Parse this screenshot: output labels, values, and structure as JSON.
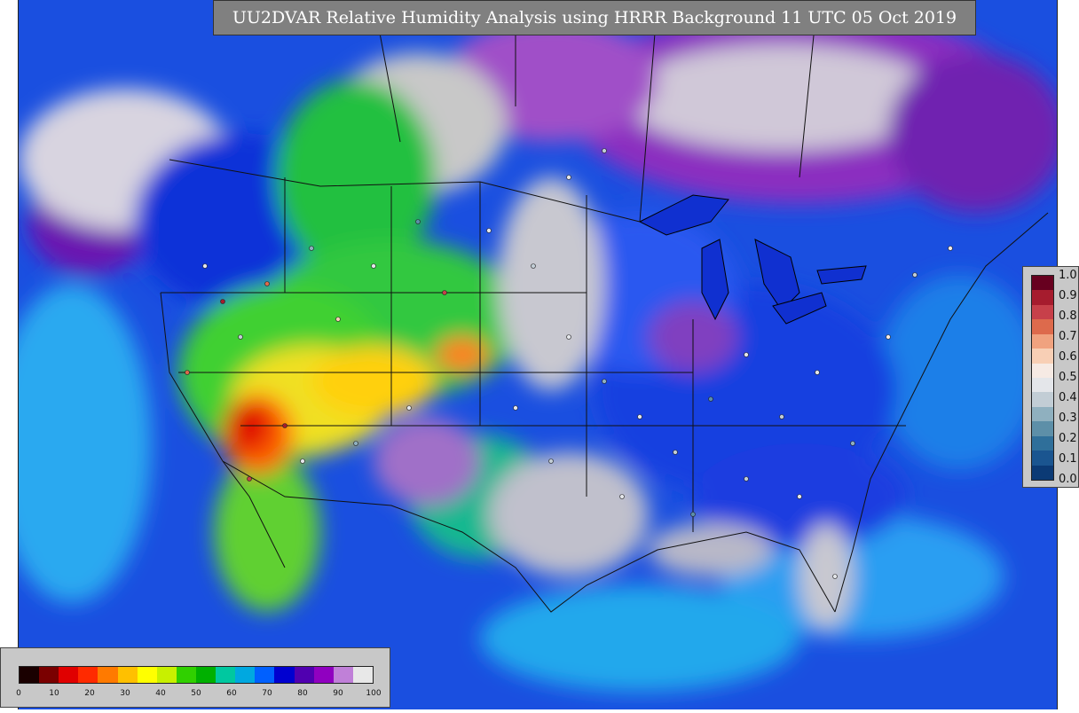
{
  "title": "UU2DVAR Relative Humidity Analysis using HRRR Background 11 UTC 05 Oct 2019",
  "observation_legend": {
    "ticks": [
      "1.0",
      "0.9",
      "0.8",
      "0.7",
      "0.6",
      "0.5",
      "0.4",
      "0.3",
      "0.2",
      "0.1",
      "0.0"
    ],
    "colors": [
      "#67001f",
      "#a61c2e",
      "#c7404a",
      "#dd6a4c",
      "#f0a27f",
      "#f8cfb5",
      "#f6eae4",
      "#e4e6ea",
      "#c2cdd5",
      "#8fb0bf",
      "#5d8fa8",
      "#2f6f9a",
      "#1a5590",
      "#0b3a75"
    ]
  },
  "rh_legend": {
    "ticks": [
      "0",
      "10",
      "20",
      "30",
      "40",
      "50",
      "60",
      "70",
      "80",
      "90",
      "100"
    ],
    "colors": [
      "#1a0000",
      "#7a0000",
      "#e00000",
      "#ff2a00",
      "#ff7a00",
      "#ffc000",
      "#ffff00",
      "#c8f000",
      "#30d000",
      "#00b000",
      "#00c8a0",
      "#00a8e0",
      "#0060ff",
      "#0000d0",
      "#5000b0",
      "#9000c0",
      "#c080d8",
      "#e8e8e8"
    ]
  }
}
